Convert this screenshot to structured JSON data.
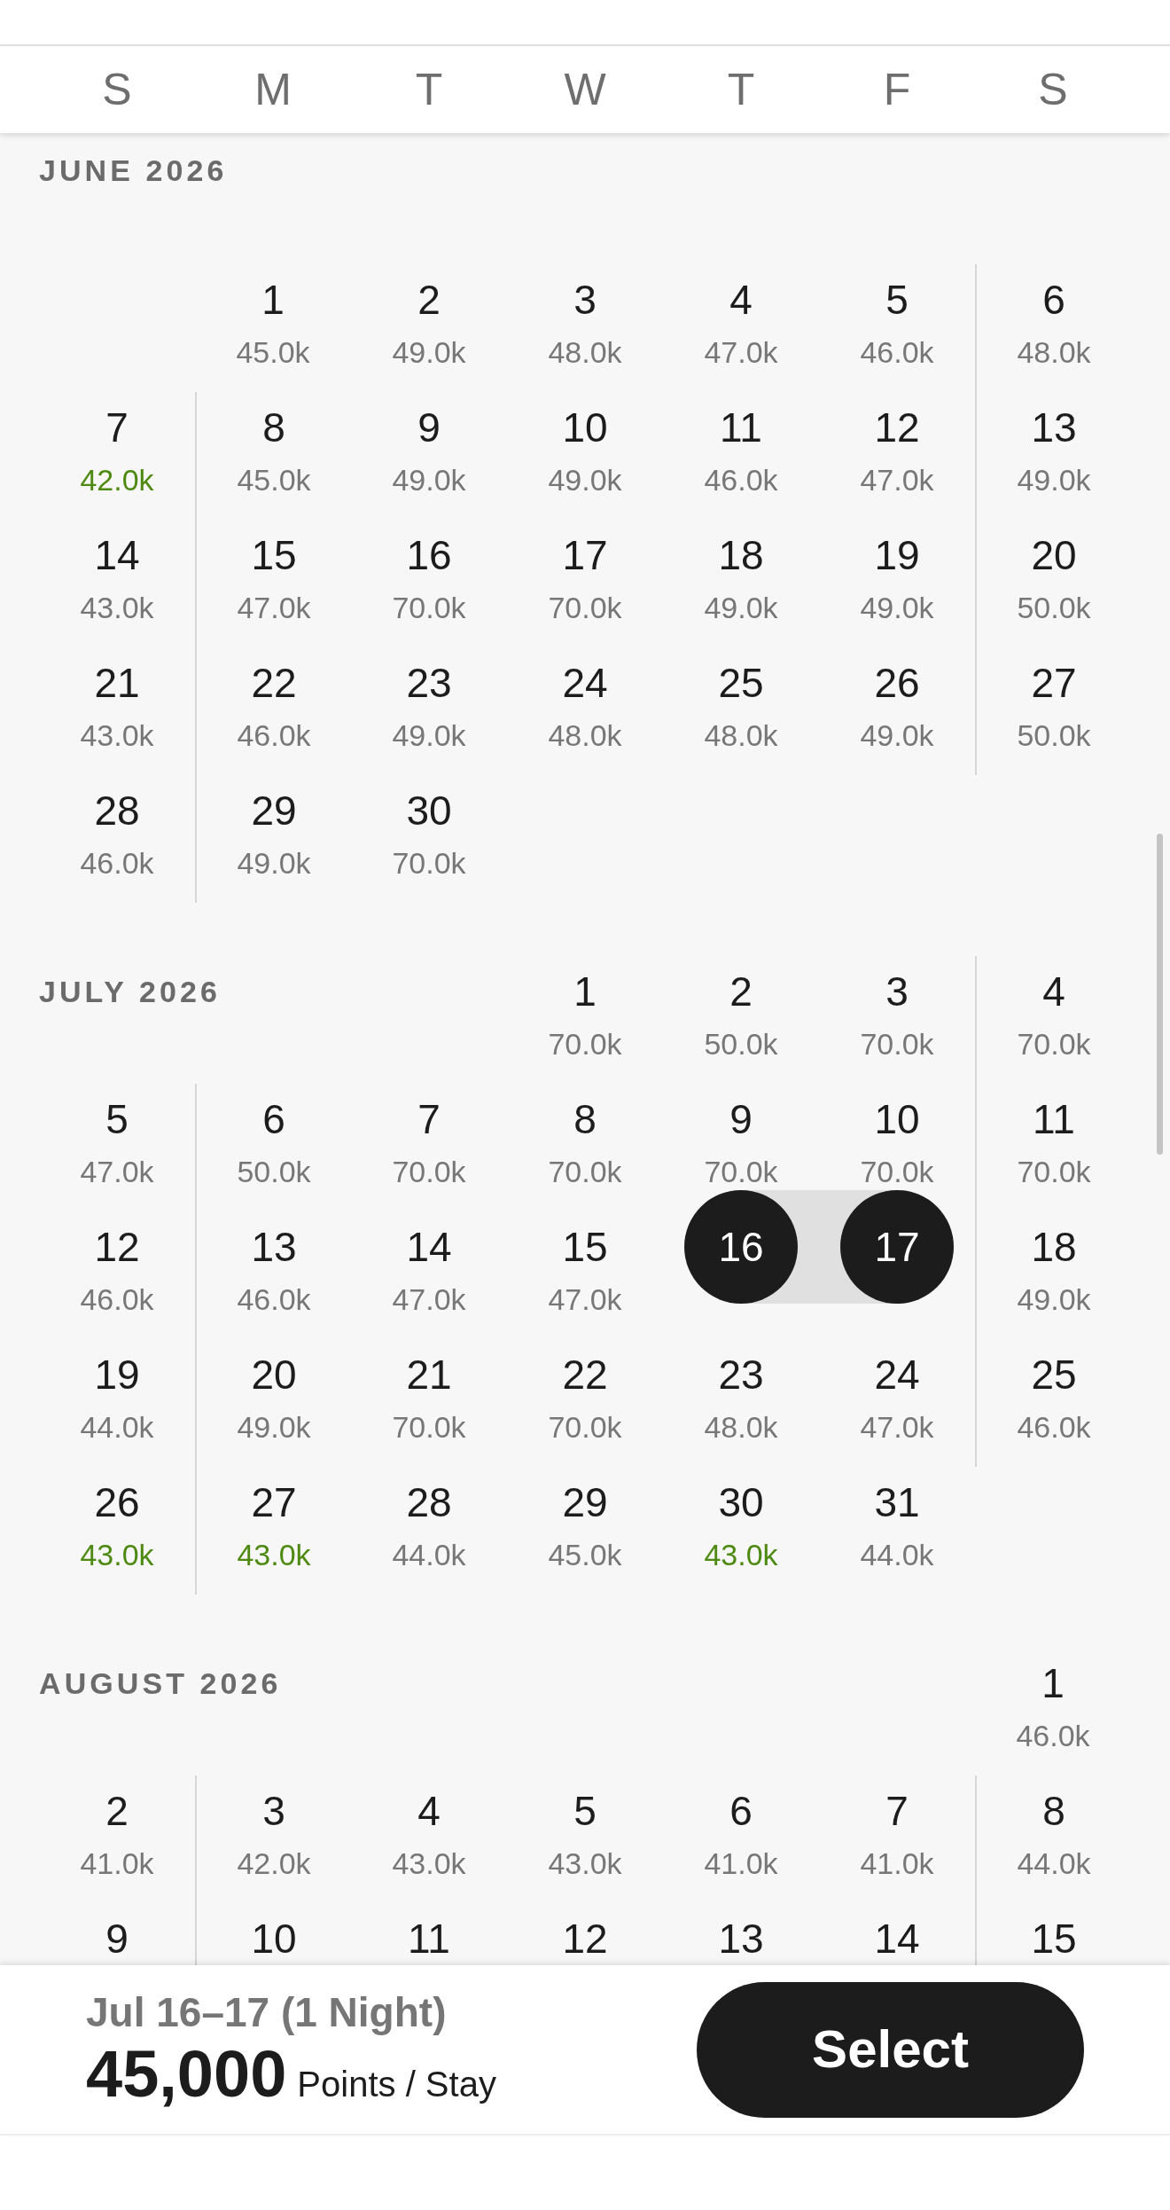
{
  "weekdays": [
    "S",
    "M",
    "T",
    "W",
    "T",
    "F",
    "S"
  ],
  "months": [
    {
      "label": "JUNE 2026",
      "weeks": [
        [
          {
            "kind": "blank"
          },
          {
            "kind": "day",
            "day": "1",
            "price": "45.0k",
            "color": "#777777",
            "selected": false
          },
          {
            "kind": "day",
            "day": "2",
            "price": "49.0k",
            "color": "#777777",
            "selected": false
          },
          {
            "kind": "day",
            "day": "3",
            "price": "48.0k",
            "color": "#777777",
            "selected": false
          },
          {
            "kind": "day",
            "day": "4",
            "price": "47.0k",
            "color": "#777777",
            "selected": false
          },
          {
            "kind": "day",
            "day": "5",
            "price": "46.0k",
            "color": "#777777",
            "selected": false
          },
          {
            "kind": "day",
            "day": "6",
            "price": "48.0k",
            "color": "#777777",
            "selected": false
          }
        ],
        [
          {
            "kind": "day",
            "day": "7",
            "price": "42.0k",
            "color": "#4e8a12",
            "selected": false
          },
          {
            "kind": "day",
            "day": "8",
            "price": "45.0k",
            "color": "#777777",
            "selected": false
          },
          {
            "kind": "day",
            "day": "9",
            "price": "49.0k",
            "color": "#777777",
            "selected": false
          },
          {
            "kind": "day",
            "day": "10",
            "price": "49.0k",
            "color": "#777777",
            "selected": false
          },
          {
            "kind": "day",
            "day": "11",
            "price": "46.0k",
            "color": "#777777",
            "selected": false
          },
          {
            "kind": "day",
            "day": "12",
            "price": "47.0k",
            "color": "#777777",
            "selected": false
          },
          {
            "kind": "day",
            "day": "13",
            "price": "49.0k",
            "color": "#777777",
            "selected": false
          }
        ],
        [
          {
            "kind": "day",
            "day": "14",
            "price": "43.0k",
            "color": "#777777",
            "selected": false
          },
          {
            "kind": "day",
            "day": "15",
            "price": "47.0k",
            "color": "#777777",
            "selected": false
          },
          {
            "kind": "day",
            "day": "16",
            "price": "70.0k",
            "color": "#777777",
            "selected": false
          },
          {
            "kind": "day",
            "day": "17",
            "price": "70.0k",
            "color": "#777777",
            "selected": false
          },
          {
            "kind": "day",
            "day": "18",
            "price": "49.0k",
            "color": "#777777",
            "selected": false
          },
          {
            "kind": "day",
            "day": "19",
            "price": "49.0k",
            "color": "#777777",
            "selected": false
          },
          {
            "kind": "day",
            "day": "20",
            "price": "50.0k",
            "color": "#777777",
            "selected": false
          }
        ],
        [
          {
            "kind": "day",
            "day": "21",
            "price": "43.0k",
            "color": "#777777",
            "selected": false
          },
          {
            "kind": "day",
            "day": "22",
            "price": "46.0k",
            "color": "#777777",
            "selected": false
          },
          {
            "kind": "day",
            "day": "23",
            "price": "49.0k",
            "color": "#777777",
            "selected": false
          },
          {
            "kind": "day",
            "day": "24",
            "price": "48.0k",
            "color": "#777777",
            "selected": false
          },
          {
            "kind": "day",
            "day": "25",
            "price": "48.0k",
            "color": "#777777",
            "selected": false
          },
          {
            "kind": "day",
            "day": "26",
            "price": "49.0k",
            "color": "#777777",
            "selected": false
          },
          {
            "kind": "day",
            "day": "27",
            "price": "50.0k",
            "color": "#777777",
            "selected": false
          }
        ],
        [
          {
            "kind": "day",
            "day": "28",
            "price": "46.0k",
            "color": "#777777",
            "selected": false
          },
          {
            "kind": "day",
            "day": "29",
            "price": "49.0k",
            "color": "#777777",
            "selected": false
          },
          {
            "kind": "day",
            "day": "30",
            "price": "70.0k",
            "color": "#777777",
            "selected": false
          },
          {
            "kind": "blank"
          },
          {
            "kind": "blank"
          },
          {
            "kind": "blank"
          },
          {
            "kind": "blank"
          }
        ]
      ]
    },
    {
      "label": "JULY 2026",
      "weeks": [
        [
          {
            "kind": "blank"
          },
          {
            "kind": "blank"
          },
          {
            "kind": "blank"
          },
          {
            "kind": "day",
            "day": "1",
            "price": "70.0k",
            "color": "#777777",
            "selected": false
          },
          {
            "kind": "day",
            "day": "2",
            "price": "50.0k",
            "color": "#777777",
            "selected": false
          },
          {
            "kind": "day",
            "day": "3",
            "price": "70.0k",
            "color": "#777777",
            "selected": false
          },
          {
            "kind": "day",
            "day": "4",
            "price": "70.0k",
            "color": "#777777",
            "selected": false
          }
        ],
        [
          {
            "kind": "day",
            "day": "5",
            "price": "47.0k",
            "color": "#777777",
            "selected": false
          },
          {
            "kind": "day",
            "day": "6",
            "price": "50.0k",
            "color": "#777777",
            "selected": false
          },
          {
            "kind": "day",
            "day": "7",
            "price": "70.0k",
            "color": "#777777",
            "selected": false
          },
          {
            "kind": "day",
            "day": "8",
            "price": "70.0k",
            "color": "#777777",
            "selected": false
          },
          {
            "kind": "day",
            "day": "9",
            "price": "70.0k",
            "color": "#777777",
            "selected": false
          },
          {
            "kind": "day",
            "day": "10",
            "price": "70.0k",
            "color": "#777777",
            "selected": false
          },
          {
            "kind": "day",
            "day": "11",
            "price": "70.0k",
            "color": "#777777",
            "selected": false
          }
        ],
        [
          {
            "kind": "day",
            "day": "12",
            "price": "46.0k",
            "color": "#777777",
            "selected": false
          },
          {
            "kind": "day",
            "day": "13",
            "price": "46.0k",
            "color": "#777777",
            "selected": false
          },
          {
            "kind": "day",
            "day": "14",
            "price": "47.0k",
            "color": "#777777",
            "selected": false
          },
          {
            "kind": "day",
            "day": "15",
            "price": "47.0k",
            "color": "#777777",
            "selected": false
          },
          {
            "kind": "day",
            "day": "16",
            "selected": true
          },
          {
            "kind": "day",
            "day": "17",
            "selected": true
          },
          {
            "kind": "day",
            "day": "18",
            "price": "49.0k",
            "color": "#777777",
            "selected": false
          }
        ],
        [
          {
            "kind": "day",
            "day": "19",
            "price": "44.0k",
            "color": "#777777",
            "selected": false
          },
          {
            "kind": "day",
            "day": "20",
            "price": "49.0k",
            "color": "#777777",
            "selected": false
          },
          {
            "kind": "day",
            "day": "21",
            "price": "70.0k",
            "color": "#777777",
            "selected": false
          },
          {
            "kind": "day",
            "day": "22",
            "price": "70.0k",
            "color": "#777777",
            "selected": false
          },
          {
            "kind": "day",
            "day": "23",
            "price": "48.0k",
            "color": "#777777",
            "selected": false
          },
          {
            "kind": "day",
            "day": "24",
            "price": "47.0k",
            "color": "#777777",
            "selected": false
          },
          {
            "kind": "day",
            "day": "25",
            "price": "46.0k",
            "color": "#777777",
            "selected": false
          }
        ],
        [
          {
            "kind": "day",
            "day": "26",
            "price": "43.0k",
            "color": "#4e8a12",
            "selected": false
          },
          {
            "kind": "day",
            "day": "27",
            "price": "43.0k",
            "color": "#4e8a12",
            "selected": false
          },
          {
            "kind": "day",
            "day": "28",
            "price": "44.0k",
            "color": "#777777",
            "selected": false
          },
          {
            "kind": "day",
            "day": "29",
            "price": "45.0k",
            "color": "#777777",
            "selected": false
          },
          {
            "kind": "day",
            "day": "30",
            "price": "43.0k",
            "color": "#4e8a12",
            "selected": false
          },
          {
            "kind": "day",
            "day": "31",
            "price": "44.0k",
            "color": "#777777",
            "selected": false
          },
          {
            "kind": "blank"
          }
        ]
      ]
    },
    {
      "label": "AUGUST 2026",
      "weeks": [
        [
          {
            "kind": "blank"
          },
          {
            "kind": "blank"
          },
          {
            "kind": "blank"
          },
          {
            "kind": "blank"
          },
          {
            "kind": "blank"
          },
          {
            "kind": "blank"
          },
          {
            "kind": "day",
            "day": "1",
            "price": "46.0k",
            "color": "#777777",
            "selected": false
          }
        ],
        [
          {
            "kind": "day",
            "day": "2",
            "price": "41.0k",
            "color": "#777777",
            "selected": false
          },
          {
            "kind": "day",
            "day": "3",
            "price": "42.0k",
            "color": "#777777",
            "selected": false
          },
          {
            "kind": "day",
            "day": "4",
            "price": "43.0k",
            "color": "#777777",
            "selected": false
          },
          {
            "kind": "day",
            "day": "5",
            "price": "43.0k",
            "color": "#777777",
            "selected": false
          },
          {
            "kind": "day",
            "day": "6",
            "price": "41.0k",
            "color": "#777777",
            "selected": false
          },
          {
            "kind": "day",
            "day": "7",
            "price": "41.0k",
            "color": "#777777",
            "selected": false
          },
          {
            "kind": "day",
            "day": "8",
            "price": "44.0k",
            "color": "#777777",
            "selected": false
          }
        ],
        [
          {
            "kind": "day",
            "day": "9",
            "selected": false
          },
          {
            "kind": "day",
            "day": "10",
            "selected": false
          },
          {
            "kind": "day",
            "day": "11",
            "selected": false
          },
          {
            "kind": "day",
            "day": "12",
            "selected": false
          },
          {
            "kind": "day",
            "day": "13",
            "selected": false
          },
          {
            "kind": "day",
            "day": "14",
            "selected": false
          },
          {
            "kind": "day",
            "day": "15",
            "selected": false
          }
        ]
      ]
    }
  ],
  "footer": {
    "dates": "Jul 16–17 (1 Night)",
    "points": "45,000",
    "unit": "Points / Stay",
    "button": "Select"
  }
}
